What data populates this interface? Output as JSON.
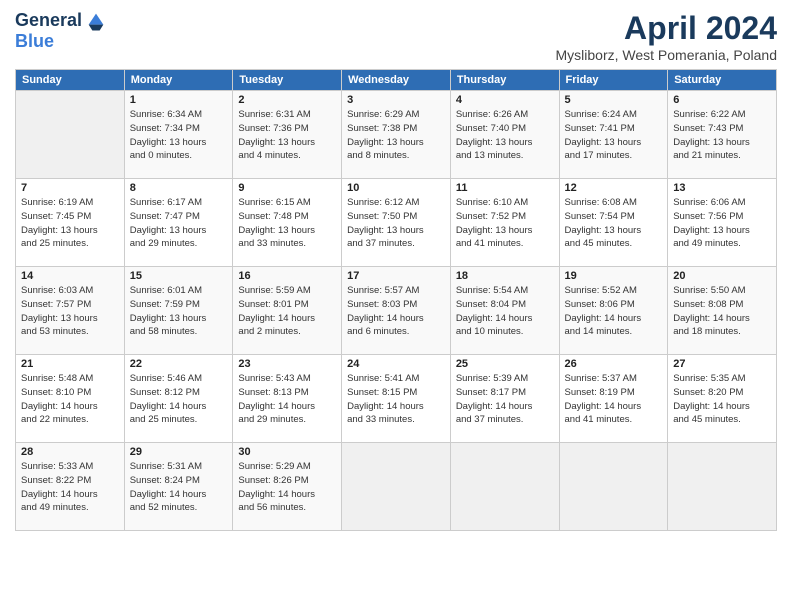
{
  "logo": {
    "line1": "General",
    "line2": "Blue"
  },
  "title": "April 2024",
  "location": "Mysliborz, West Pomerania, Poland",
  "days_header": [
    "Sunday",
    "Monday",
    "Tuesday",
    "Wednesday",
    "Thursday",
    "Friday",
    "Saturday"
  ],
  "weeks": [
    [
      {
        "num": "",
        "detail": ""
      },
      {
        "num": "1",
        "detail": "Sunrise: 6:34 AM\nSunset: 7:34 PM\nDaylight: 13 hours\nand 0 minutes."
      },
      {
        "num": "2",
        "detail": "Sunrise: 6:31 AM\nSunset: 7:36 PM\nDaylight: 13 hours\nand 4 minutes."
      },
      {
        "num": "3",
        "detail": "Sunrise: 6:29 AM\nSunset: 7:38 PM\nDaylight: 13 hours\nand 8 minutes."
      },
      {
        "num": "4",
        "detail": "Sunrise: 6:26 AM\nSunset: 7:40 PM\nDaylight: 13 hours\nand 13 minutes."
      },
      {
        "num": "5",
        "detail": "Sunrise: 6:24 AM\nSunset: 7:41 PM\nDaylight: 13 hours\nand 17 minutes."
      },
      {
        "num": "6",
        "detail": "Sunrise: 6:22 AM\nSunset: 7:43 PM\nDaylight: 13 hours\nand 21 minutes."
      }
    ],
    [
      {
        "num": "7",
        "detail": "Sunrise: 6:19 AM\nSunset: 7:45 PM\nDaylight: 13 hours\nand 25 minutes."
      },
      {
        "num": "8",
        "detail": "Sunrise: 6:17 AM\nSunset: 7:47 PM\nDaylight: 13 hours\nand 29 minutes."
      },
      {
        "num": "9",
        "detail": "Sunrise: 6:15 AM\nSunset: 7:48 PM\nDaylight: 13 hours\nand 33 minutes."
      },
      {
        "num": "10",
        "detail": "Sunrise: 6:12 AM\nSunset: 7:50 PM\nDaylight: 13 hours\nand 37 minutes."
      },
      {
        "num": "11",
        "detail": "Sunrise: 6:10 AM\nSunset: 7:52 PM\nDaylight: 13 hours\nand 41 minutes."
      },
      {
        "num": "12",
        "detail": "Sunrise: 6:08 AM\nSunset: 7:54 PM\nDaylight: 13 hours\nand 45 minutes."
      },
      {
        "num": "13",
        "detail": "Sunrise: 6:06 AM\nSunset: 7:56 PM\nDaylight: 13 hours\nand 49 minutes."
      }
    ],
    [
      {
        "num": "14",
        "detail": "Sunrise: 6:03 AM\nSunset: 7:57 PM\nDaylight: 13 hours\nand 53 minutes."
      },
      {
        "num": "15",
        "detail": "Sunrise: 6:01 AM\nSunset: 7:59 PM\nDaylight: 13 hours\nand 58 minutes."
      },
      {
        "num": "16",
        "detail": "Sunrise: 5:59 AM\nSunset: 8:01 PM\nDaylight: 14 hours\nand 2 minutes."
      },
      {
        "num": "17",
        "detail": "Sunrise: 5:57 AM\nSunset: 8:03 PM\nDaylight: 14 hours\nand 6 minutes."
      },
      {
        "num": "18",
        "detail": "Sunrise: 5:54 AM\nSunset: 8:04 PM\nDaylight: 14 hours\nand 10 minutes."
      },
      {
        "num": "19",
        "detail": "Sunrise: 5:52 AM\nSunset: 8:06 PM\nDaylight: 14 hours\nand 14 minutes."
      },
      {
        "num": "20",
        "detail": "Sunrise: 5:50 AM\nSunset: 8:08 PM\nDaylight: 14 hours\nand 18 minutes."
      }
    ],
    [
      {
        "num": "21",
        "detail": "Sunrise: 5:48 AM\nSunset: 8:10 PM\nDaylight: 14 hours\nand 22 minutes."
      },
      {
        "num": "22",
        "detail": "Sunrise: 5:46 AM\nSunset: 8:12 PM\nDaylight: 14 hours\nand 25 minutes."
      },
      {
        "num": "23",
        "detail": "Sunrise: 5:43 AM\nSunset: 8:13 PM\nDaylight: 14 hours\nand 29 minutes."
      },
      {
        "num": "24",
        "detail": "Sunrise: 5:41 AM\nSunset: 8:15 PM\nDaylight: 14 hours\nand 33 minutes."
      },
      {
        "num": "25",
        "detail": "Sunrise: 5:39 AM\nSunset: 8:17 PM\nDaylight: 14 hours\nand 37 minutes."
      },
      {
        "num": "26",
        "detail": "Sunrise: 5:37 AM\nSunset: 8:19 PM\nDaylight: 14 hours\nand 41 minutes."
      },
      {
        "num": "27",
        "detail": "Sunrise: 5:35 AM\nSunset: 8:20 PM\nDaylight: 14 hours\nand 45 minutes."
      }
    ],
    [
      {
        "num": "28",
        "detail": "Sunrise: 5:33 AM\nSunset: 8:22 PM\nDaylight: 14 hours\nand 49 minutes."
      },
      {
        "num": "29",
        "detail": "Sunrise: 5:31 AM\nSunset: 8:24 PM\nDaylight: 14 hours\nand 52 minutes."
      },
      {
        "num": "30",
        "detail": "Sunrise: 5:29 AM\nSunset: 8:26 PM\nDaylight: 14 hours\nand 56 minutes."
      },
      {
        "num": "",
        "detail": ""
      },
      {
        "num": "",
        "detail": ""
      },
      {
        "num": "",
        "detail": ""
      },
      {
        "num": "",
        "detail": ""
      }
    ]
  ]
}
